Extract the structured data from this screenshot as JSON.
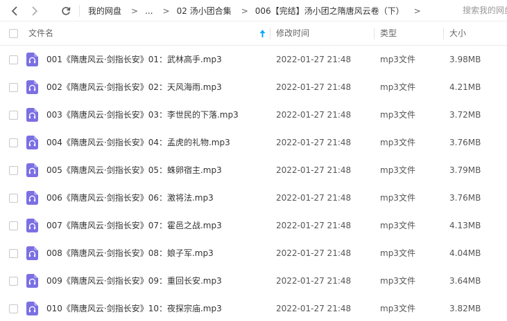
{
  "toolbar": {
    "back_icon": "chevron-left-icon",
    "forward_icon": "chevron-right-icon",
    "refresh_icon": "refresh-icon"
  },
  "breadcrumb": {
    "items": [
      "我的网盘",
      "...",
      "02 汤小团合集",
      "006【完结】汤小团之隋唐风云卷（下）"
    ],
    "separator": ">"
  },
  "search": {
    "placeholder": "搜索我的网盘"
  },
  "columns": {
    "name": "文件名",
    "modified": "修改时间",
    "type": "类型",
    "size": "大小"
  },
  "colors": {
    "file_icon": "#7b6fe4",
    "sort_arrow": "#06a7ff",
    "text": "#333333",
    "muted": "#999999"
  },
  "files": [
    {
      "name": "001《隋唐风云·剑指长安》01：武林高手.mp3",
      "modified": "2022-01-27 21:48",
      "type": "mp3文件",
      "size": "3.98MB",
      "icon": "audio-file-icon"
    },
    {
      "name": "002《隋唐风云·剑指长安》02：天风海雨.mp3",
      "modified": "2022-01-27 21:48",
      "type": "mp3文件",
      "size": "4.21MB",
      "icon": "audio-file-icon"
    },
    {
      "name": "003《隋唐风云·剑指长安》03：李世民的下落.mp3",
      "modified": "2022-01-27 21:48",
      "type": "mp3文件",
      "size": "3.72MB",
      "icon": "audio-file-icon"
    },
    {
      "name": "004《隋唐风云·剑指长安》04：孟虎的礼物.mp3",
      "modified": "2022-01-27 21:48",
      "type": "mp3文件",
      "size": "3.76MB",
      "icon": "audio-file-icon"
    },
    {
      "name": "005《隋唐风云·剑指长安》05：蛛卵宿主.mp3",
      "modified": "2022-01-27 21:48",
      "type": "mp3文件",
      "size": "3.79MB",
      "icon": "audio-file-icon"
    },
    {
      "name": "006《隋唐风云·剑指长安》06：激将法.mp3",
      "modified": "2022-01-27 21:48",
      "type": "mp3文件",
      "size": "3.76MB",
      "icon": "audio-file-icon"
    },
    {
      "name": "007《隋唐风云·剑指长安》07：霍邑之战.mp3",
      "modified": "2022-01-27 21:48",
      "type": "mp3文件",
      "size": "4.13MB",
      "icon": "audio-file-icon"
    },
    {
      "name": "008《隋唐风云·剑指长安》08：娘子军.mp3",
      "modified": "2022-01-27 21:48",
      "type": "mp3文件",
      "size": "4.04MB",
      "icon": "audio-file-icon"
    },
    {
      "name": "009《隋唐风云·剑指长安》09：重回长安.mp3",
      "modified": "2022-01-27 21:48",
      "type": "mp3文件",
      "size": "3.64MB",
      "icon": "audio-file-icon"
    },
    {
      "name": "010《隋唐风云·剑指长安》10：夜探宗庙.mp3",
      "modified": "2022-01-27 21:48",
      "type": "mp3文件",
      "size": "3.82MB",
      "icon": "audio-file-icon"
    }
  ]
}
